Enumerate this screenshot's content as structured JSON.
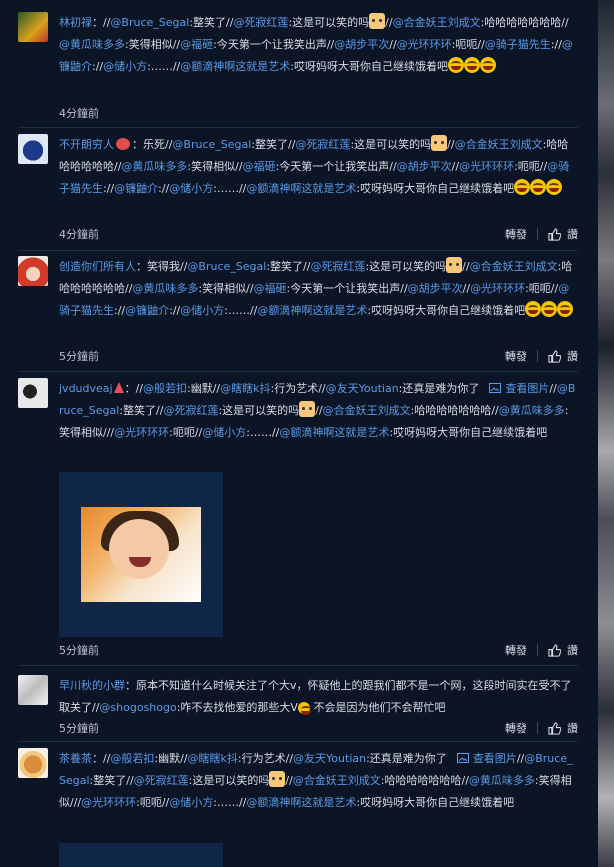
{
  "comments": [
    {
      "name": "林初禄",
      "sep": "：",
      "t1": "//",
      "m1": "@Bruce_Segal",
      "t2": ":整笑了//",
      "m2": "@死寂红莲",
      "t3": ":这是可以笑的吗",
      "t4": "//",
      "m3": "@合金妖王刘成文",
      "t5": ":哈哈哈哈哈哈哈//",
      "m4": "@黄瓜味多多",
      "t6": ":笑得相似//",
      "m5": "@福砸",
      "t7": ":今天第一个让我笑出声//",
      "m6": "@胡步平次",
      "t8": "//",
      "m7": "@光环环环",
      "t9": ":呃呃//",
      "m8": "@骑子猫先生",
      "t10": "://",
      "m9": "@镰鼬介",
      "t11": "://",
      "m10": "@储小方",
      "t12": ":……//",
      "m11": "@额滴神啊这就是艺术",
      "t13": ":哎呀妈呀大哥你自己继续饿着吧",
      "time": "4分鐘前"
    },
    {
      "name": "不开朗穷人",
      "t1": "：乐死//",
      "m1": "@Bruce_Segal",
      "t2": ":整笑了//",
      "m2": "@死寂红莲",
      "t3": ":这是可以笑的吗",
      "t4": "//",
      "m3": "@合金妖王刘成文",
      "t5": ":哈哈哈哈哈哈哈//",
      "m4": "@黄瓜味多多",
      "t6": ":笑得相似//",
      "m5": "@福砸",
      "t7": ":今天第一个让我笑出声//",
      "m6": "@胡步平次",
      "t8": "//",
      "m7": "@光环环环",
      "t9": ":呃呃//",
      "m8": "@骑子猫先生",
      "t10": "://",
      "m9": "@镰鼬介",
      "t11": "://",
      "m10": "@储小方",
      "t12": ":……//",
      "m11": "@额滴神啊这就是艺术",
      "t13": ":哎呀妈呀大哥你自己继续饿着吧",
      "time": "4分鐘前",
      "repost": "轉發",
      "like": "讚"
    },
    {
      "name": "创造你们所有人",
      "t1": "：笑得我//",
      "m1": "@Bruce_Segal",
      "t2": ":整笑了//",
      "m2": "@死寂红莲",
      "t3": ":这是可以笑的吗",
      "t4": "//",
      "m3": "@合金妖王刘成文",
      "t5": ":哈哈哈哈哈哈哈//",
      "m4": "@黄瓜味多多",
      "t6": ":笑得相似//",
      "m5": "@福砸",
      "t7": ":今天第一个让我笑出声//",
      "m6": "@胡步平次",
      "t8": "//",
      "m7": "@光环环环",
      "t9": ":呃呃//",
      "m8": "@骑子猫先生",
      "t10": "://",
      "m9": "@镰鼬介",
      "t11": "://",
      "m10": "@储小方",
      "t12": ":……//",
      "m11": "@额滴神啊这就是艺术",
      "t13": ":哎呀妈呀大哥你自己继续饿着吧",
      "time": "5分鐘前",
      "repost": "轉發",
      "like": "讚"
    },
    {
      "name": "jvdudveaj",
      "t1": "：//",
      "m1": "@般若扣",
      "t2": ":幽默//",
      "m2": "@瞎瞎k抖",
      "t3": ":行为艺术//",
      "m3": "@友天Youtian",
      "t4": ":还真是难为你了",
      "pic": "查看图片",
      "t5": "//",
      "m4": "@Bruce_Segal",
      "t6": ":整笑了//",
      "m5": "@死寂红莲",
      "t7": ":这是可以笑的吗",
      "t8": "//",
      "m6": "@合金妖王刘成文",
      "t9": ":哈哈哈哈哈哈哈//",
      "m7": "@黄瓜味多多",
      "t10": ":笑得相似///",
      "m8": "@光环环环",
      "t11": ":呃呃//",
      "m9": "@储小方",
      "t12": ":……//",
      "m10": "@额滴神啊这就是艺术",
      "t13": ":哎呀妈呀大哥你自己继续饿着吧",
      "time": "5分鐘前",
      "repost": "轉發",
      "like": "讚"
    },
    {
      "name": "早川秋的小群",
      "t1": "：原本不知道什么时候关注了个大v，怀疑他上的跟我们都不是一个网，这段时间实在受不了取关了//",
      "m1": "@shogoshogo",
      "t2": ":咋不去找他爱的那些大V",
      "t3": " 不会是因为他们不会帮忙吧",
      "time": "5分鐘前",
      "repost": "轉發",
      "like": "讚"
    },
    {
      "name": "茶養茶",
      "t1": "：//",
      "m1": "@般若扣",
      "t2": ":幽默//",
      "m2": "@瞎瞎k抖",
      "t3": ":行为艺术//",
      "m3": "@友天Youtian",
      "t4": ":还真是难为你了",
      "pic": "查看图片",
      "t5": "//",
      "m4": "@Bruce_Segal",
      "t6": ":整笑了//",
      "m5": "@死寂红莲",
      "t7": ":这是可以笑的吗",
      "t8": "//",
      "m6": "@合金妖王刘成文",
      "t9": ":哈哈哈哈哈哈哈//",
      "m7": "@黄瓜味多多",
      "t10": ":笑得相似///",
      "m8": "@光环环环",
      "t11": ":呃呃//",
      "m9": "@储小方",
      "t12": ":……//",
      "m10": "@额滴神啊这就是艺术",
      "t13": ":哎呀妈呀大哥你自己继续饿着吧"
    }
  ]
}
